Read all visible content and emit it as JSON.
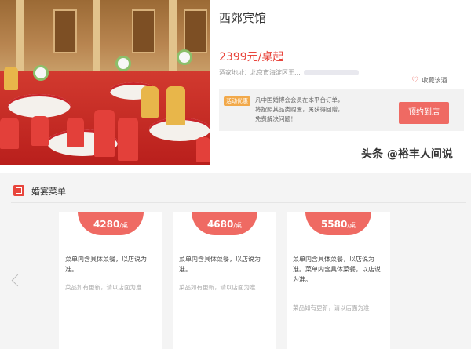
{
  "hotel": {
    "name": "西郊宾馆",
    "price": "2399元/桌起",
    "address_label": "酒家地址：北京市海淀区王...",
    "favorite_label": "收藏该酒"
  },
  "promo": {
    "tag": "活动优惠",
    "text_lines": [
      "凡中国婚博会会员在本平台订单，",
      "将按照其品类购置，属获得回赠，",
      "免费解决问题！"
    ],
    "button_label": "预约到店"
  },
  "watermark": "头条 @裕丰人间说",
  "menu_section": {
    "title": "婚宴菜单",
    "cards": [
      {
        "price": "4280",
        "unit": "/桌",
        "desc": "菜单内含具体菜餐，以店说为准。",
        "note": "菜品如有更新，请以店面为准"
      },
      {
        "price": "4680",
        "unit": "/桌",
        "desc": "菜单内含具体菜餐，以店说为准。",
        "note": "菜品如有更新，请以店面为准"
      },
      {
        "price": "5580",
        "unit": "/桌",
        "desc": "菜单内含具体菜餐，以店说为准。菜单内含具体菜餐，以店说为准。",
        "note": "菜品如有更新，请以店面为准"
      }
    ]
  },
  "icons": {
    "favorite": "heart-icon",
    "menu": "menu-book-icon",
    "carousel_prev": "chevron-left-icon"
  },
  "colors": {
    "accent": "#e8453c",
    "button": "#ef6a63",
    "tag": "#f2a94a"
  }
}
